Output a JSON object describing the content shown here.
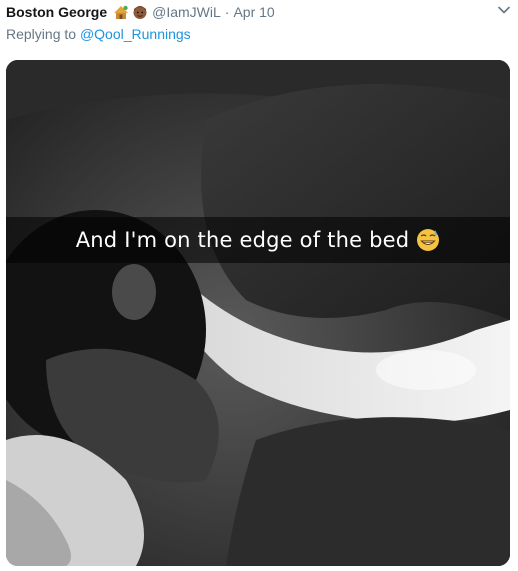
{
  "tweet": {
    "author_name": "Boston George",
    "author_emojis": [
      "house-with-tree-emoji",
      "man-medium-dark-skin-emoji"
    ],
    "handle": "@IamJWiL",
    "separator": "·",
    "date": "Apr 10",
    "replying_prefix": "Replying to",
    "replying_to": "@Qool_Runnings"
  },
  "media": {
    "caption": "And I'm on the edge of the bed",
    "caption_emoji": "grimacing-sweat-face-emoji"
  },
  "colors": {
    "link": "#1b95e0",
    "muted": "#657786",
    "text": "#14171a"
  }
}
